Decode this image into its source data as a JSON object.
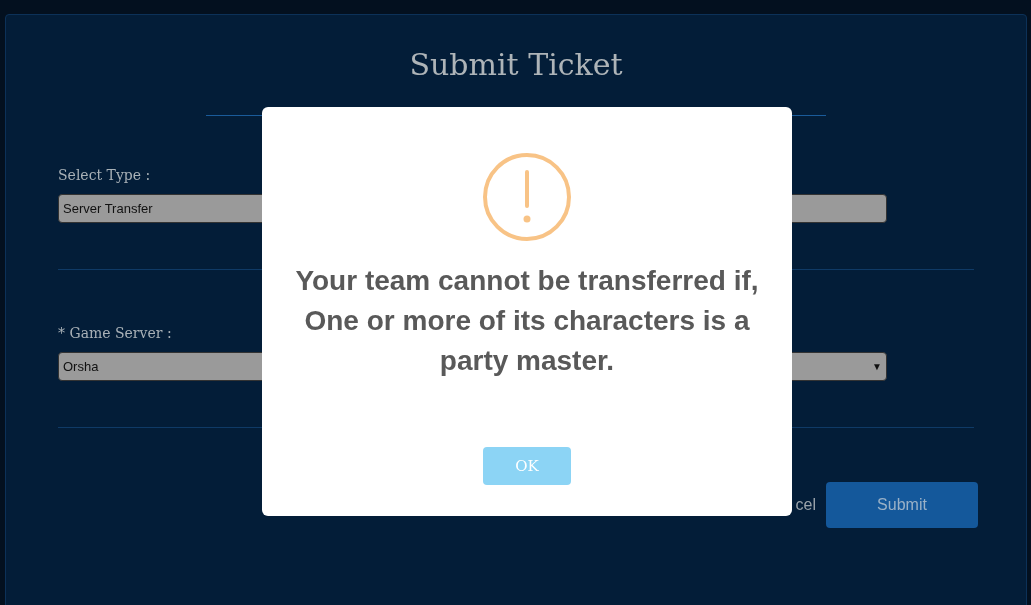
{
  "page": {
    "title": "Submit Ticket"
  },
  "form": {
    "fields": [
      {
        "label": "Select Type :",
        "value": "Server Transfer"
      },
      {
        "label": "* Game Server :",
        "value": "Orsha",
        "arrow": "▼"
      }
    ],
    "cancel": "cel",
    "submit": "Submit"
  },
  "dialog": {
    "message": "Your team cannot be transferred if, One or more of its characters is a party master.",
    "button": "OK"
  }
}
